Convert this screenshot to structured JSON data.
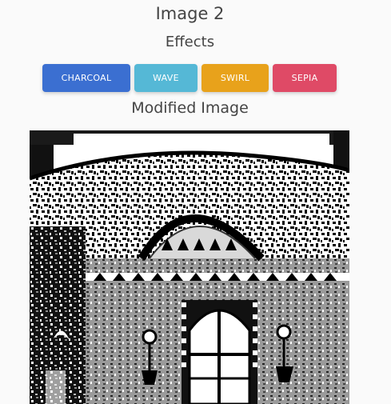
{
  "header": {
    "title": "Image 2",
    "effects_heading": "Effects"
  },
  "effects": {
    "buttons": [
      {
        "label": "CHARCOAL",
        "color": "#3b6fd1"
      },
      {
        "label": "WAVE",
        "color": "#55b8d6"
      },
      {
        "label": "SWIRL",
        "color": "#e8a21b"
      },
      {
        "label": "SEPIA",
        "color": "#df4a66"
      }
    ]
  },
  "result": {
    "heading": "Modified Image"
  }
}
